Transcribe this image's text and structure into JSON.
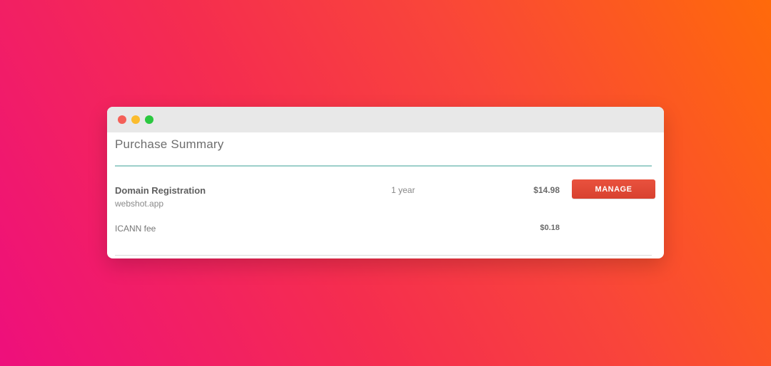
{
  "window": {
    "controls": [
      "close",
      "minimize",
      "maximize"
    ]
  },
  "summary": {
    "title": "Purchase Summary",
    "item": {
      "name": "Domain Registration",
      "domain": "webshot.app",
      "term": "1 year",
      "price": "$14.98",
      "action_label": "MANAGE"
    },
    "fee": {
      "name": "ICANN fee",
      "price": "$0.18"
    }
  },
  "colors": {
    "accent_rule": "#9ccfca",
    "manage_button": "#e14a37",
    "gradient_start": "#ee0f7c",
    "gradient_end": "#ff6a0a"
  }
}
